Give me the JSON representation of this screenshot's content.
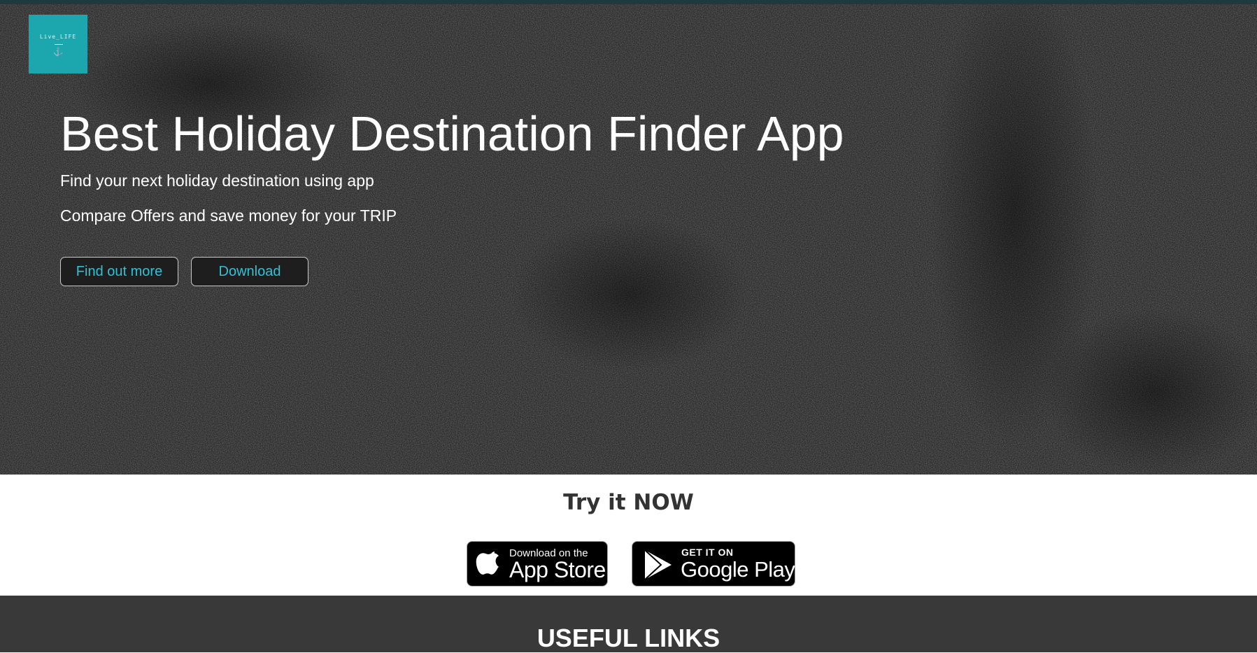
{
  "logo": {
    "text": "Live_LIFE",
    "mark": "⚓"
  },
  "hero": {
    "title": "Best Holiday Destination Finder App",
    "subtitle_1": "Find your next holiday destination using app",
    "subtitle_2": "Compare Offers and save money for your TRIP",
    "find_out_more_label": "Find out more",
    "download_label": "Download"
  },
  "try_section": {
    "title": "Try it NOW",
    "app_store": {
      "small": "Download on the",
      "big": "App Store",
      "icon": "apple-icon"
    },
    "google_play": {
      "small": "GET IT ON",
      "big": "Google Play",
      "icon": "play-icon"
    }
  },
  "footer": {
    "title": "USEFUL LINKS"
  },
  "colors": {
    "accent": "#2fc2d6",
    "logo_bg": "#1ba7ad",
    "hero_bg": "#262626",
    "footer_bg": "#393939"
  }
}
